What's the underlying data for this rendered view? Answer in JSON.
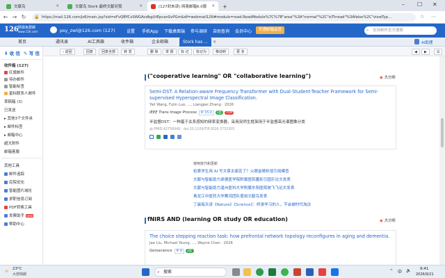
{
  "browser": {
    "tabs": [
      {
        "label": "文献鸟"
      },
      {
        "label": "文献鸟 Stork 最终文献对我"
      },
      {
        "label": "(127封未读) 网易邮箱6.0版"
      }
    ],
    "new_tab": "+",
    "url": "https://mail.126.com/js6/main.jsp?sid=eFvQBYCvSWGAcdbgUtEpcanSvPGm&df=webmail126#module=read.ReadModule%7C%7B\"area\"%3A\"normal\"%2C\"isThread\"%3Afalse%2C\"viewTyp..."
  },
  "mail_header": {
    "logo": "126",
    "logo_sub": "网易免费邮",
    "logo_domain": "www.126.com",
    "account": "psy_zwl@126.com (127)",
    "nav": [
      "设置",
      "手机App",
      "下载桌面端",
      "参与调研",
      "自助查询",
      "会员中心"
    ],
    "vip": "开通邮箱会员",
    "search_placeholder": "支持邮件全文搜索",
    "ai_helper": "AI助理"
  },
  "module_tabs": [
    {
      "label": "首页"
    },
    {
      "label": "通讯录"
    },
    {
      "label": "AI工具箱"
    },
    {
      "label": "收件箱"
    },
    {
      "label": "企业邮箱"
    },
    {
      "label": "Stork has ..."
    }
  ],
  "sidebar": {
    "receive": "收 信",
    "compose": "写 信",
    "items": [
      {
        "label": "收件箱 (127)",
        "bold": true
      },
      {
        "label": "红旗邮件"
      },
      {
        "label": "待办邮件"
      },
      {
        "label": "智能标签"
      },
      {
        "label": "星标联系人邮件"
      },
      {
        "label": "草稿箱 (3)"
      },
      {
        "label": "已发送"
      },
      {
        "label": "其他3个文件夹"
      },
      {
        "label": "邮件标签"
      },
      {
        "label": "邮箱中心"
      },
      {
        "label": "超大附件"
      },
      {
        "label": "邮箱客服"
      },
      {
        "label": "其他工具"
      },
      {
        "label": "邮件追踪"
      },
      {
        "label": "后院优化"
      },
      {
        "label": "智能图片减化"
      },
      {
        "label": "求职信息订阅"
      },
      {
        "label": "PDF转换工具"
      },
      {
        "label": "发票助手",
        "tag": "NEW"
      },
      {
        "label": "帮助中心"
      }
    ]
  },
  "toolbar": {
    "buttons": [
      "返回",
      "回复",
      "回复全部",
      "转 发",
      "删 除",
      "举 报",
      "标 记",
      "标记为",
      "移动到",
      "更 多"
    ],
    "prev": "◀",
    "next": "▶",
    "menu": "☰"
  },
  "content": {
    "sections": [
      {
        "title": "(\"cooperative learning\" OR \"collaborative learning\")",
        "translate": "大分析"
      },
      {
        "title": "fNIRS AND (learning OR study OR education)",
        "translate": "大分析"
      }
    ],
    "paper1": {
      "title": "Semi-DST: A Relation-aware Frequency Transformer with Dual-Student-Teacher Framework for Semi-supervised Hyperspectral Image Classification.",
      "authors": "Yali Wang, Fulin Luo, ..., Liangpei Zhang · 2026",
      "journal": "IEEE Trans Image Process",
      "if": "IF 15.3",
      "quartile": "1区",
      "top": "TOP",
      "cn_title": "半监督DST：一种基于关系感知的频率变换器，采用双师生框架用于半监督高光谱图像分类",
      "pmid": "PMID:42758949 · doi:10.1109/TIP.2026.3732305"
    },
    "links_header": "使用技巧和更新",
    "links": [
      "检索学生用 AI 写文章太痛苦了？火眼金睛析增引用模查",
      "文献与智能助力承德医学院附属医院董影引国乐论文发表",
      "文献与智能助力温州医科大学附属东阳医院坡飞飞论文发表",
      "奥龙江中医药大学赛鸿团队使用文献鸟发表",
      "丁晨每天读《Nature》《Science》：终身学习的人，不会被时代淘汰"
    ],
    "paper2": {
      "title": "The choice stepping reaction task: how prefrontal network topology reconfigures in aging and dementia.",
      "authors": "Jae Liu, Michael Yeung, ..., Wayne Chan · 2026",
      "journal": "Geroscience",
      "if": "IF 6",
      "quartile": "2区"
    }
  },
  "taskbar": {
    "weather_temp": "23°C",
    "weather_desc": "大部晴朗",
    "search": "搜索",
    "time": "9:41",
    "date": "2026/9/21",
    "lang": "中"
  }
}
